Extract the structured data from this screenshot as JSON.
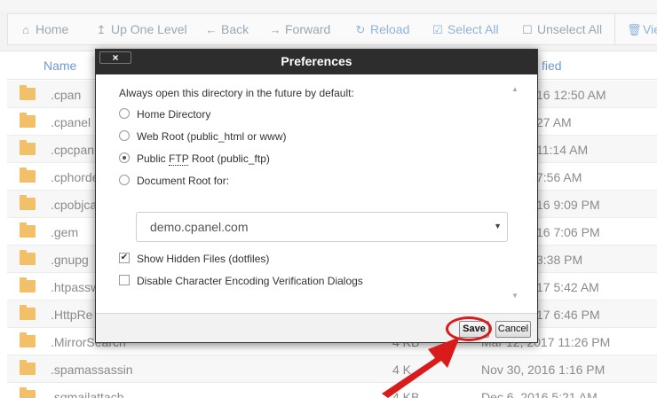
{
  "toolbar": {
    "home": "Home",
    "up_one_level": "Up One Level",
    "back": "Back",
    "forward": "Forward",
    "reload": "Reload",
    "select_all": "Select All",
    "unselect_all": "Unselect All",
    "view": "Vie"
  },
  "list": {
    "col_name": "Name",
    "col_modified": "fied",
    "rows": [
      {
        "name": ".cpan",
        "size": "",
        "date": "16 12:50 AM"
      },
      {
        "name": ".cpanel",
        "size": "",
        "date": "27 AM"
      },
      {
        "name": ".cpcpan",
        "size": "",
        "date": "11:14 AM"
      },
      {
        "name": ".cphorde",
        "size": "",
        "date": "7:56 AM"
      },
      {
        "name": ".cpobjca",
        "size": "",
        "date": "16 9:09 PM"
      },
      {
        "name": ".gem",
        "size": "",
        "date": "16 7:06 PM"
      },
      {
        "name": ".gnupg",
        "size": "",
        "date": "3:38 PM"
      },
      {
        "name": ".htpassw",
        "size": "",
        "date": "17 5:42 AM"
      },
      {
        "name": ".HttpRe",
        "size": "",
        "date": "17 6:46 PM"
      },
      {
        "name": ".MirrorSearch",
        "size": "4 KB",
        "date": "Mar 12, 2017 11:26 PM"
      },
      {
        "name": ".spamassassin",
        "size": "4 K",
        "date": "Nov 30, 2016 1:16 PM"
      },
      {
        "name": ".sqmailattach",
        "size": "4 KB",
        "date": "Dec 6, 2016 5:21 AM"
      }
    ]
  },
  "dialog": {
    "title": "Preferences",
    "close_label": "×",
    "intro": "Always open this directory in the future by default:",
    "options": {
      "home_directory": "Home Directory",
      "web_root": "Web Root (public_html or www)",
      "ftp_prefix": "Public ",
      "ftp_abbr": "FTP",
      "ftp_suffix": " Root (public_ftp)",
      "document_root": "Document Root for:"
    },
    "selected_option": "public_ftp",
    "domain_select": "demo.cpanel.com",
    "show_hidden": "Show Hidden Files (dotfiles)",
    "show_hidden_checked": true,
    "disable_encoding": "Disable Character Encoding Verification Dialogs",
    "disable_encoding_checked": false,
    "save_label": "Save",
    "cancel_label": "Cancel"
  },
  "colors": {
    "annotation": "#d81c1c",
    "title_bar": "#2d2d2d",
    "toolbar_text": "#9aa7b4",
    "link": "#6b9bd1"
  },
  "icons": {
    "home": "home-icon",
    "up": "level-up-icon",
    "back": "arrow-left-icon",
    "forward": "arrow-right-icon",
    "reload": "reload-icon",
    "select_all": "check-square-icon",
    "unselect_all": "square-icon",
    "view": "trash-icon",
    "folder": "folder-icon"
  }
}
